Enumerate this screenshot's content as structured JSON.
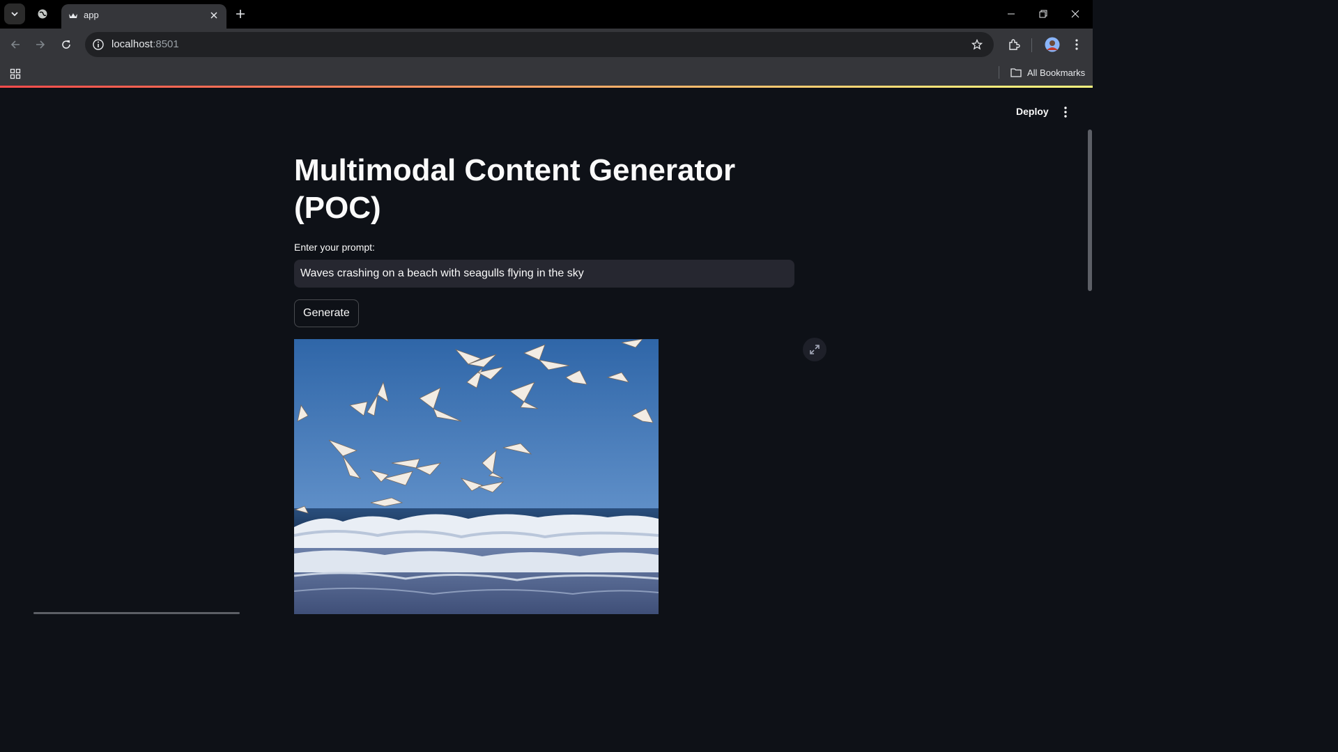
{
  "browser": {
    "tab": {
      "title": "app"
    },
    "url": {
      "host": "localhost",
      "port": ":8501"
    },
    "bookmarks": {
      "all_label": "All Bookmarks"
    }
  },
  "app": {
    "header": {
      "deploy_label": "Deploy"
    },
    "title_line1": "Multimodal Content Generator",
    "title_line2": "(POC)",
    "prompt_label": "Enter your prompt:",
    "prompt_value": "Waves crashing on a beach with seagulls flying in the sky",
    "generate_label": "Generate",
    "image_alt": "Generated image: seagulls flying over waves crashing on a beach"
  },
  "colors": {
    "app_bg": "#0e1117",
    "input_bg": "#262730",
    "decoration_start": "#ff4b4b",
    "decoration_end": "#fffd80",
    "chrome_toolbar": "#35363a",
    "chrome_tabstrip": "#000000"
  },
  "icons": [
    "tab-search-icon",
    "tab-group-icon",
    "streamlit-favicon-icon",
    "close-icon",
    "plus-icon",
    "minimize-icon",
    "restore-icon",
    "window-close-icon",
    "back-arrow-icon",
    "forward-arrow-icon",
    "reload-icon",
    "info-icon",
    "star-icon",
    "extensions-icon",
    "profile-avatar-icon",
    "kebab-menu-icon",
    "apps-grid-icon",
    "folder-icon",
    "fullscreen-expand-icon"
  ]
}
